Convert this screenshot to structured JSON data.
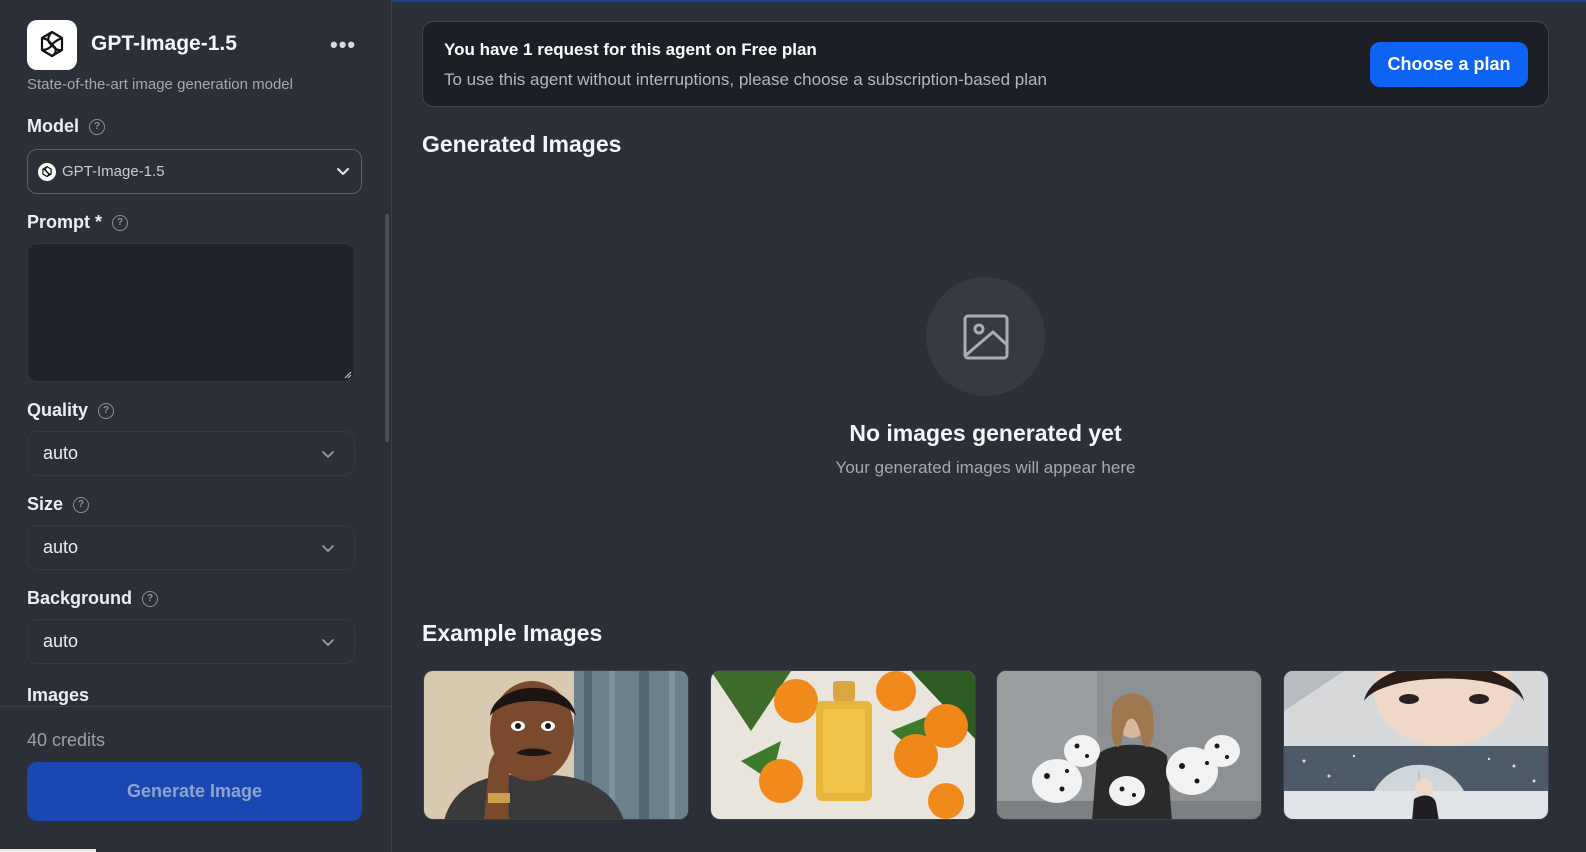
{
  "agent": {
    "title": "GPT-Image-1.5",
    "subtitle": "State-of-the-art image generation model",
    "more_label": "•••"
  },
  "form": {
    "model_label": "Model",
    "model_value": "GPT-Image-1.5",
    "prompt_label": "Prompt *",
    "prompt_value": "",
    "quality_label": "Quality",
    "quality_value": "auto",
    "size_label": "Size",
    "size_value": "auto",
    "background_label": "Background",
    "background_value": "auto",
    "images_label": "Images"
  },
  "footer": {
    "credits": "40 credits",
    "generate_label": "Generate Image"
  },
  "banner": {
    "title": "You have 1 request for this agent on Free plan",
    "text": "To use this agent without interruptions, please choose a subscription-based plan",
    "button_label": "Choose a plan"
  },
  "main": {
    "generated_title": "Generated Images",
    "empty_title": "No images generated yet",
    "empty_subtitle": "Your generated images will appear here",
    "examples_title": "Example Images",
    "examples": [
      {
        "icon": "cartoon-man-thinking-image"
      },
      {
        "icon": "perfume-and-oranges-image"
      },
      {
        "icon": "woman-with-dalmatians-image"
      },
      {
        "icon": "woman-in-snow-image"
      }
    ]
  },
  "colors": {
    "background": "#2b2f38",
    "accent": "#0d63f3",
    "generate_button": "#1a47b0",
    "banner_bg": "#1c1f26"
  }
}
